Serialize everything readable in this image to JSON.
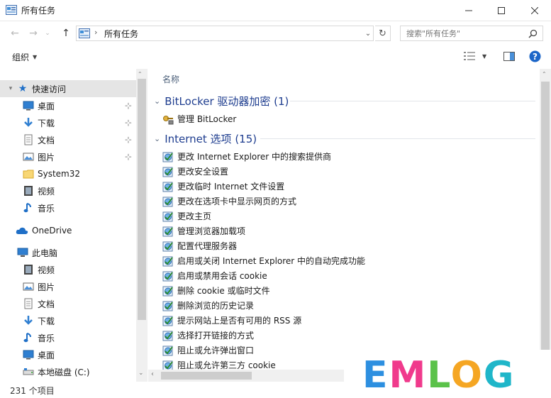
{
  "window": {
    "title": "所有任务"
  },
  "address": {
    "path": "所有任务"
  },
  "search": {
    "placeholder": "搜索\"所有任务\""
  },
  "toolbar": {
    "organize_label": "组织"
  },
  "nav": {
    "quick_access": "快速访问",
    "quick_items": [
      {
        "label": "桌面",
        "icon": "desktop-icon"
      },
      {
        "label": "下载",
        "icon": "download-icon"
      },
      {
        "label": "文档",
        "icon": "document-icon"
      },
      {
        "label": "图片",
        "icon": "pictures-icon"
      },
      {
        "label": "System32",
        "icon": "folder-icon"
      },
      {
        "label": "视频",
        "icon": "videos-icon"
      },
      {
        "label": "音乐",
        "icon": "music-icon"
      }
    ],
    "onedrive": "OneDrive",
    "this_pc": "此电脑",
    "pc_items": [
      {
        "label": "视频",
        "icon": "videos-icon"
      },
      {
        "label": "图片",
        "icon": "pictures-icon"
      },
      {
        "label": "文档",
        "icon": "document-icon"
      },
      {
        "label": "下载",
        "icon": "download-icon"
      },
      {
        "label": "音乐",
        "icon": "music-icon"
      },
      {
        "label": "桌面",
        "icon": "desktop-icon"
      },
      {
        "label": "本地磁盘 (C:)",
        "icon": "drive-icon"
      }
    ]
  },
  "list": {
    "column_name": "名称",
    "groups": [
      {
        "title": "BitLocker 驱动器加密 (1)",
        "items": [
          "管理 BitLocker"
        ]
      },
      {
        "title": "Internet 选项 (15)",
        "items": [
          "更改 Internet Explorer 中的搜索提供商",
          "更改安全设置",
          "更改临时 Internet 文件设置",
          "更改在选项卡中显示网页的方式",
          "更改主页",
          "管理浏览器加载项",
          "配置代理服务器",
          "启用或关闭 Internet Explorer 中的自动完成功能",
          "启用或禁用会话 cookie",
          "删除 cookie 或临时文件",
          "删除浏览的历史记录",
          "提示网站上是否有可用的 RSS 源",
          "选择打开链接的方式",
          "阻止或允许弹出窗口",
          "阻止或允许第三方 cookie"
        ]
      }
    ]
  },
  "status": {
    "count": "231 个项目"
  },
  "watermark": {
    "text": "EMLOG"
  },
  "colors": {
    "accent_blue": "#1e3d8f",
    "watermark_blue": "#2d8fe0",
    "watermark_green": "#5bc24a"
  }
}
